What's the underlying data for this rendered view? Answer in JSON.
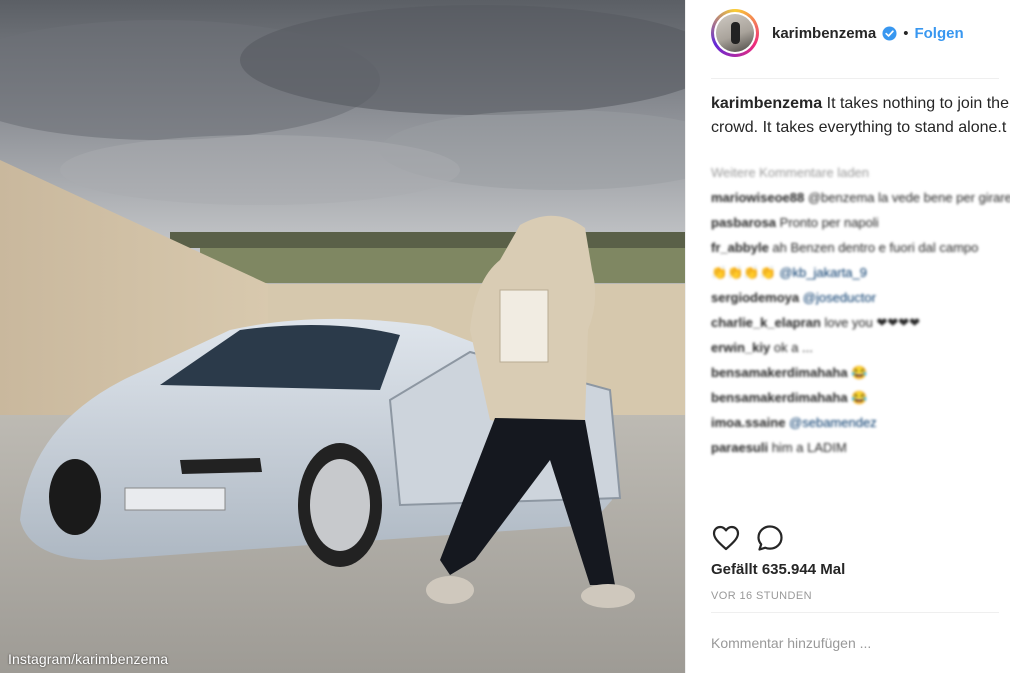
{
  "photo": {
    "watermark": "Instagram/karimbenzema"
  },
  "post": {
    "username": "karimbenzema",
    "verified": true,
    "separator": "•",
    "follow_label": "Folgen",
    "caption_username": "karimbenzema",
    "caption_text": " It takes nothing to join the crowd. It takes everything to stand alone.t",
    "load_more": "Weitere Kommentare laden",
    "comments": [
      {
        "user": "mariowiseoe88",
        "text": " @benzema la vede bene per girare a Napoli"
      },
      {
        "user": "pasbarosa",
        "text": " Pronto per napoli"
      },
      {
        "user": "fr_abbyle",
        "text": " ah Benzen dentro e fuori dal campo"
      },
      {
        "user": "",
        "text": "👏👏👏👏 @kb_jakarta_9"
      },
      {
        "user": "sergiodemoya",
        "text": " @joseductor"
      },
      {
        "user": "charlie_k_elapran",
        "text": " love you ❤❤❤❤"
      },
      {
        "user": "erwin_kiy",
        "text": " ok a ..."
      },
      {
        "user": "bensamakerdimahaha",
        "text": " 😂"
      },
      {
        "user": "bensamakerdimahaha",
        "text": " 😂"
      },
      {
        "user": "imoa.ssaine",
        "text": " @sebamendez"
      },
      {
        "user": "paraesuli",
        "text": " him a LADIM"
      }
    ],
    "likes_label": "Gefällt 635.944 Mal",
    "timestamp": "VOR 16 STUNDEN",
    "comment_placeholder": "Kommentar hinzufügen ..."
  },
  "icons": {
    "like": "heart-outline-icon",
    "comment": "speech-bubble-icon",
    "verified": "verified-badge-icon"
  },
  "colors": {
    "link_blue": "#3897f0",
    "text_dark": "#262626",
    "muted": "#999999",
    "divider": "#efefef"
  }
}
